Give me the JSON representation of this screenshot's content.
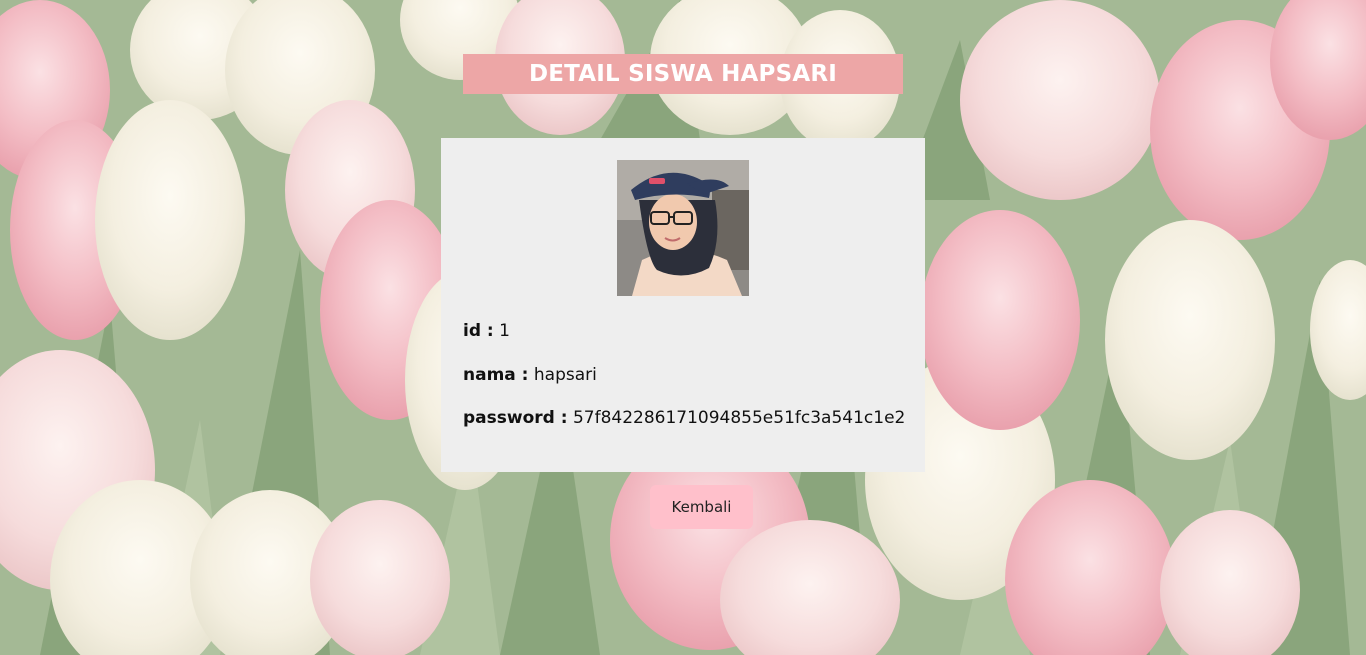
{
  "page": {
    "title": "DETAIL SISWA HAPSARI"
  },
  "student": {
    "photo_alt": "hapsari",
    "fields": [
      {
        "label": "id :",
        "value": "1"
      },
      {
        "label": "nama :",
        "value": "hapsari"
      },
      {
        "label": "password :",
        "value": "57f842286171094855e51fc3a541c1e2"
      }
    ]
  },
  "actions": {
    "back_label": "Kembali"
  },
  "colors": {
    "title_bg": "#eda6a6",
    "card_bg": "#eeeeee",
    "button_bg": "#ffc0cb",
    "background_green": "#9bb38d",
    "tulip_pink": "#f2b8c0",
    "tulip_white": "#f7f1e4"
  }
}
